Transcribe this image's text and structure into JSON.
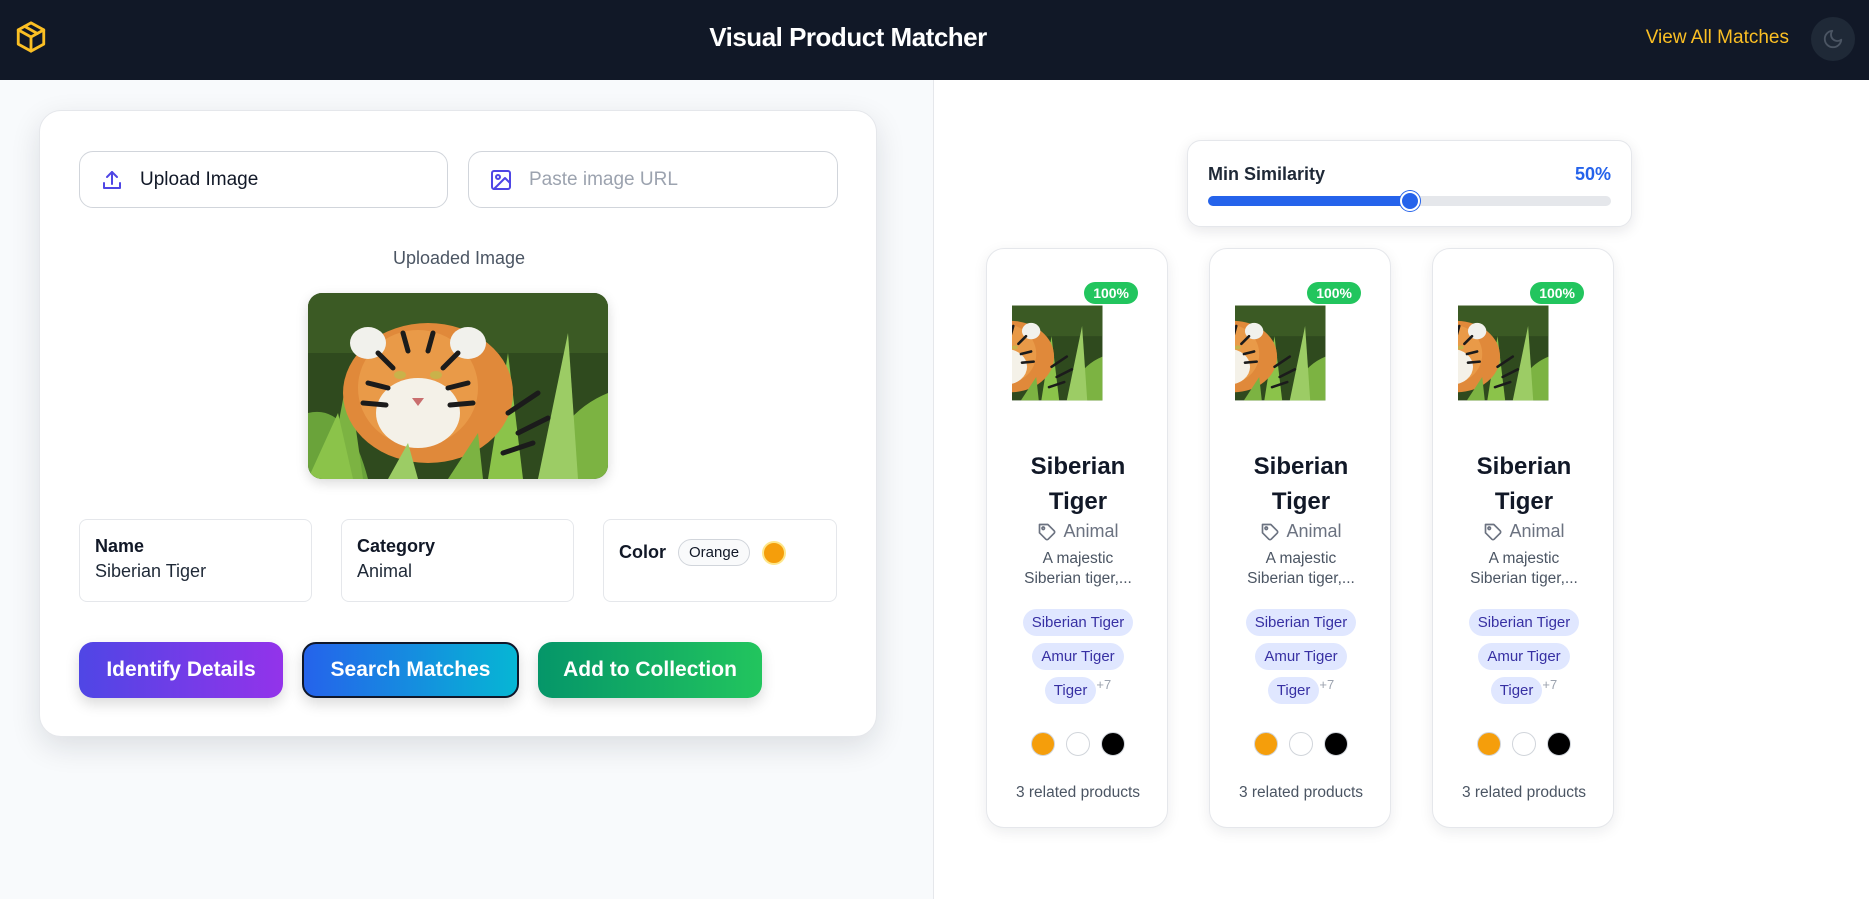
{
  "header": {
    "title": "Visual Product Matcher",
    "view_all_label": "View All Matches"
  },
  "upload": {
    "upload_label": "Upload Image",
    "url_placeholder": "Paste image URL",
    "uploaded_image_label": "Uploaded Image"
  },
  "details": {
    "name_label": "Name",
    "name_value": "Siberian Tiger",
    "category_label": "Category",
    "category_value": "Animal",
    "color_label": "Color",
    "color_value": "Orange",
    "color_hex": "#f59e0b"
  },
  "actions": {
    "identify_label": "Identify Details",
    "search_label": "Search Matches",
    "add_label": "Add to Collection"
  },
  "filter": {
    "label": "Min Similarity",
    "value_text": "50%",
    "value": 0.5
  },
  "results": [
    {
      "badge": "100%",
      "title": "Siberian Tiger",
      "category": "Animal",
      "description": "A majestic Siberian tiger,...",
      "tags": [
        "Siberian Tiger",
        "Amur Tiger",
        "Tiger"
      ],
      "more_tags": "+7",
      "colors": [
        "#f59e0b",
        "#ffffff",
        "#000000"
      ],
      "related": "3 related products"
    },
    {
      "badge": "100%",
      "title": "Siberian Tiger",
      "category": "Animal",
      "description": "A majestic Siberian tiger,...",
      "tags": [
        "Siberian Tiger",
        "Amur Tiger",
        "Tiger"
      ],
      "more_tags": "+7",
      "colors": [
        "#f59e0b",
        "#ffffff",
        "#000000"
      ],
      "related": "3 related products"
    },
    {
      "badge": "100%",
      "title": "Siberian Tiger",
      "category": "Animal",
      "description": "A majestic Siberian tiger,...",
      "tags": [
        "Siberian Tiger",
        "Amur Tiger",
        "Tiger"
      ],
      "more_tags": "+7",
      "colors": [
        "#f59e0b",
        "#ffffff",
        "#000000"
      ],
      "related": "3 related products"
    }
  ],
  "colors": {
    "header_bg": "#111827",
    "accent_yellow": "#fbbf24",
    "primary_blue": "#2563eb",
    "match_green": "#22c55e"
  }
}
